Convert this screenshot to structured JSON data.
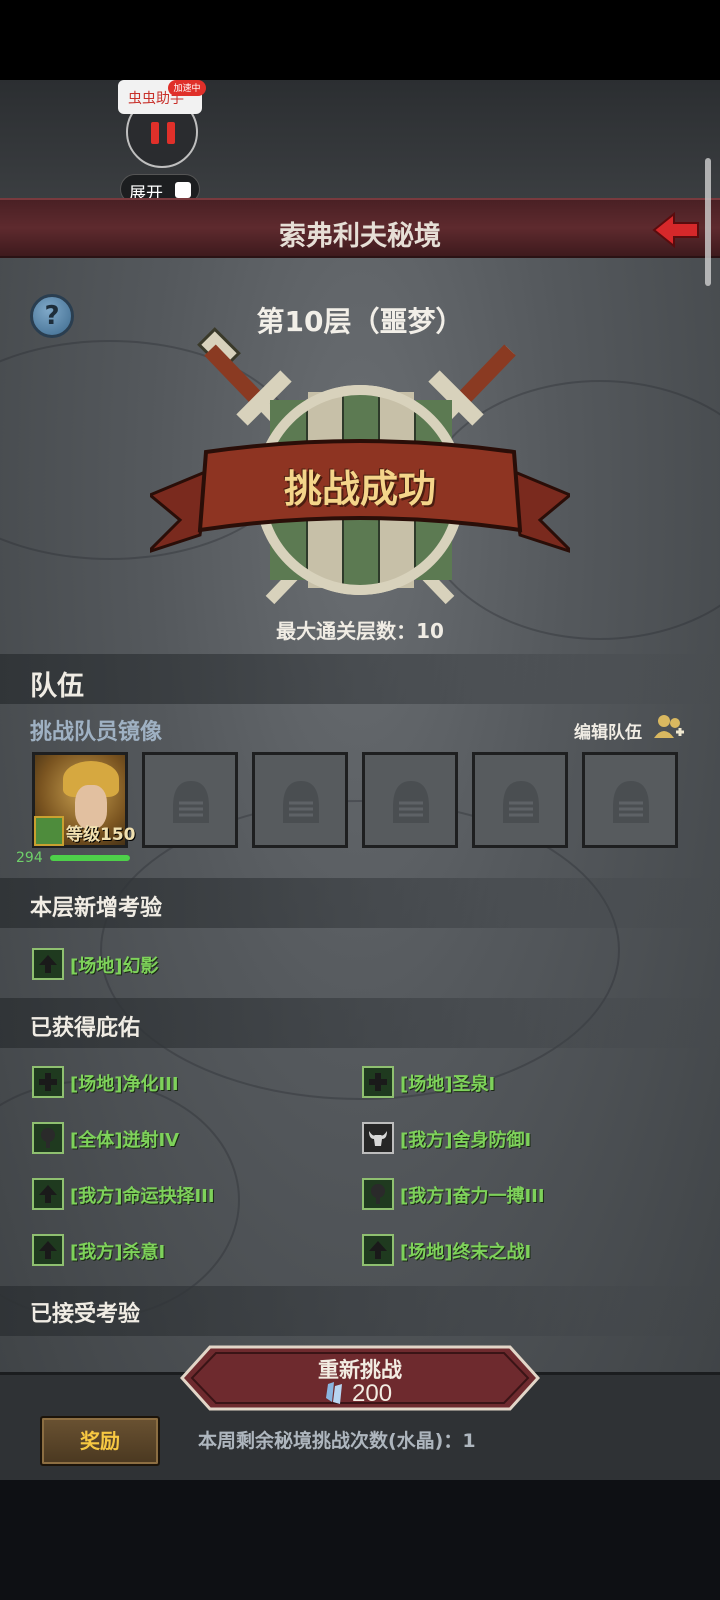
{
  "assistant": {
    "app_name": "虫虫助手",
    "badge": "加速中",
    "expand_label": "展开"
  },
  "header": {
    "title": "索弗利夫秘境"
  },
  "result": {
    "floor": "第10层（噩梦）",
    "status": "挑战成功",
    "max_floor": "最大通关层数：10"
  },
  "team": {
    "section_title": "队伍",
    "members_label": "挑战队员镜像",
    "edit_label": "编辑队伍",
    "hero": {
      "level": "等级150",
      "power": "294",
      "hp_fraction": 1.0
    },
    "empty_slots": 5
  },
  "trials": {
    "section_title": "本层新增考验",
    "items": [
      {
        "text": "[场地]幻影",
        "icon": "arrow-up-icon"
      }
    ]
  },
  "blessings": {
    "section_title": "已获得庇佑",
    "items": [
      {
        "text": "[场地]净化III",
        "icon": "cross-icon"
      },
      {
        "text": "[场地]圣泉I",
        "icon": "cross-icon"
      },
      {
        "text": "[全体]迸射IV",
        "icon": "tree-icon"
      },
      {
        "text": "[我方]舍身防御I",
        "icon": "bull-skull-icon"
      },
      {
        "text": "[我方]命运抉择III",
        "icon": "arrow-up-icon"
      },
      {
        "text": "[我方]奋力一搏III",
        "icon": "tree-icon"
      },
      {
        "text": "[我方]杀意I",
        "icon": "arrow-up-icon"
      },
      {
        "text": "[场地]终末之战I",
        "icon": "arrow-up-icon"
      }
    ]
  },
  "accepted": {
    "section_title": "已接受考验"
  },
  "footer": {
    "retry_label": "重新挑战",
    "retry_cost": "200",
    "reward_label": "奖励",
    "weekly_info": "本周剩余秘境挑战次数(水晶)：1"
  },
  "colors": {
    "title_bar": "#5e2a2e",
    "buff_text": "#7ed25a",
    "reward_text": "#f7c842",
    "accent_red": "#e0302a"
  }
}
